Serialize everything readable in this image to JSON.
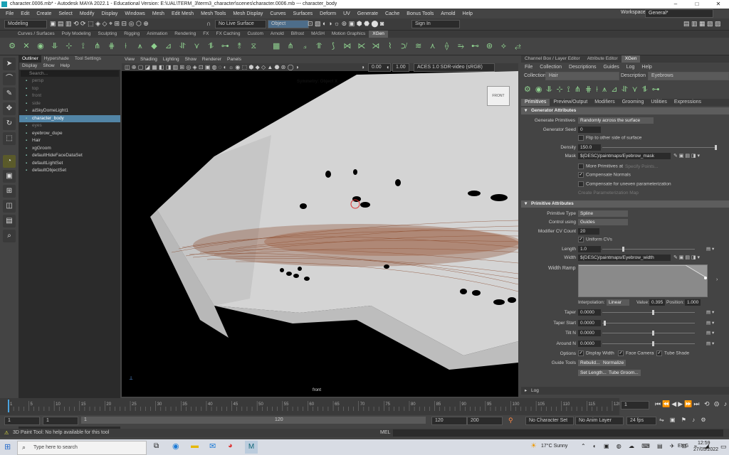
{
  "window": {
    "title": "character.0006.mb* - Autodesk MAYA 2022.1 - Educational Version: E:\\UAL\\TERM_3\\term3_character\\scenes\\character.0006.mb  ---  character_body",
    "minimize": "–",
    "maximize": "□",
    "close": "✕"
  },
  "menu": {
    "items": [
      "File",
      "Edit",
      "Create",
      "Select",
      "Modify",
      "Display",
      "Windows",
      "Mesh",
      "Edit Mesh",
      "Mesh Tools",
      "Mesh Display",
      "Curves",
      "Surfaces",
      "Deform",
      "UV",
      "Generate",
      "Cache",
      "Bonus Tools",
      "Arnold",
      "Help"
    ],
    "workspace_label": "Workspace:",
    "workspace_value": "General*"
  },
  "status": {
    "mode": "Modeling",
    "live_surface": "No Live Surface",
    "object": "Object",
    "sign_in": "Sign In"
  },
  "shelf": {
    "tabs": [
      "Curves / Surfaces",
      "Poly Modeling",
      "Sculpting",
      "Rigging",
      "Animation",
      "Rendering",
      "FX",
      "FX Caching",
      "Custom",
      "Arnold",
      "Bifrost",
      "MASH",
      "Motion Graphics",
      "XGen"
    ],
    "active": "XGen"
  },
  "outliner": {
    "tabs": [
      "Outliner",
      "Hypershade",
      "Tool Settings"
    ],
    "menu": [
      "Display",
      "Show",
      "Help"
    ],
    "search_placeholder": "Search...",
    "items": [
      {
        "label": "persp",
        "dim": true,
        "selected": false
      },
      {
        "label": "top",
        "dim": true,
        "selected": false
      },
      {
        "label": "front",
        "dim": true,
        "selected": false
      },
      {
        "label": "side",
        "dim": true,
        "selected": false
      },
      {
        "label": "aiSkyDomeLight1",
        "dim": false,
        "selected": false
      },
      {
        "label": "character_body",
        "dim": false,
        "selected": true
      },
      {
        "label": "eyes",
        "dim": true,
        "selected": false
      },
      {
        "label": "eyebrow_dupe",
        "dim": false,
        "selected": false
      },
      {
        "label": "Hair",
        "dim": false,
        "selected": false
      },
      {
        "label": "xgGroom",
        "dim": false,
        "selected": false
      },
      {
        "label": "defaultHideFaceDataSet",
        "dim": false,
        "selected": false
      },
      {
        "label": "defaultLightSet",
        "dim": false,
        "selected": false
      },
      {
        "label": "defaultObjectSet",
        "dim": false,
        "selected": false
      }
    ]
  },
  "viewport": {
    "menu": [
      "View",
      "Shading",
      "Lighting",
      "Show",
      "Renderer",
      "Panels"
    ],
    "exposure": "0.00",
    "gamma": "1.00",
    "color_space": "ACES 1.0 SDR-video (sRGB)",
    "symmetry_label": "Symmetry: Object X",
    "cube_label": "FRONT",
    "camera_label": "front"
  },
  "right_panel": {
    "tabs": [
      "Channel Box / Layer Editor",
      "Attribute Editor",
      "XGen"
    ],
    "active_tab": "XGen",
    "menu": [
      "File",
      "Collection",
      "Descriptions",
      "Guides",
      "Log",
      "Help"
    ],
    "collection_label": "Collection",
    "collection_value": "Hair",
    "description_label": "Description",
    "description_value": "Eyebrows",
    "subtabs": [
      "Primitives",
      "Preview/Output",
      "Modifiers",
      "Grooming",
      "Utilities",
      "Expressions"
    ],
    "generator": {
      "title": "Generator Attributes",
      "gen_primitives_label": "Generate Primitives",
      "gen_primitives_value": "Randomly across the surface",
      "seed_label": "Generator Seed",
      "seed_value": "0",
      "flip_label": "Flip to other side of surface",
      "density_label": "Density",
      "density_value": "150.0",
      "mask_label": "Mask",
      "mask_value": "${DESC}/paintmaps/Eyebrow_mask",
      "more_prims_label": "More Primitives at",
      "specify_points": "Specify Points...",
      "compensate_normals": "Compensate Normals",
      "compensate_uneven": "Compensate for uneven parameterization",
      "create_param_map": "Create Parameterization Map"
    },
    "primitive": {
      "title": "Primitive Attributes",
      "type_label": "Primitive Type",
      "type_value": "Spline",
      "control_label": "Control using",
      "control_value": "Guides",
      "cv_count_label": "Modifier CV Count",
      "cv_count_value": "20",
      "uniform_cvs": "Uniform CVs",
      "length_label": "Length",
      "length_value": "1.0",
      "width_label": "Width",
      "width_value": "${DESC}/paintmaps/Eyebrow_width",
      "width_ramp_label": "Width Ramp",
      "interp_label": "Interpolation:",
      "interp_value": "Linear",
      "ramp_value_label": "Value:",
      "ramp_value": "0.395",
      "ramp_position_label": "Position:",
      "ramp_position": "1.000",
      "taper_label": "Taper",
      "taper_value": "0.0000",
      "taper_start_label": "Taper Start",
      "taper_start_value": "0.0000",
      "tilt_label": "Tilt N",
      "tilt_value": "0.0000",
      "around_label": "Around N",
      "around_value": "0.0000",
      "options_label": "Options",
      "display_width": "Display Width",
      "face_camera": "Face Camera",
      "tube_shade": "Tube Shade",
      "guide_tools_label": "Guide Tools",
      "rebuild": "Rebuild...",
      "normalize": "Normalize",
      "set_length": "Set Length...",
      "tube_groom": "Tube Groom..."
    },
    "log_label": "Log"
  },
  "timeline": {
    "ticks": [
      "1",
      "5",
      "10",
      "15",
      "20",
      "25",
      "30",
      "35",
      "40",
      "45",
      "50",
      "55",
      "60",
      "65",
      "70",
      "75",
      "80",
      "85",
      "90",
      "95",
      "100",
      "105",
      "110",
      "115",
      "120"
    ],
    "current_frame": "1"
  },
  "range": {
    "start": "1",
    "anim_start": "1",
    "slider_start": "1",
    "slider_end": "120",
    "end": "120",
    "anim_end": "200",
    "character_set": "No Character Set",
    "anim_layer": "No Anim Layer",
    "fps": "24 fps"
  },
  "command": {
    "help_text": "3D Paint Tool: No help available for this tool",
    "mel_label": "MEL"
  },
  "taskbar": {
    "search_placeholder": "Type here to search",
    "weather": "17°C  Sunny",
    "lang": "ENG",
    "time": "12:59",
    "date": "27/05/2022"
  }
}
